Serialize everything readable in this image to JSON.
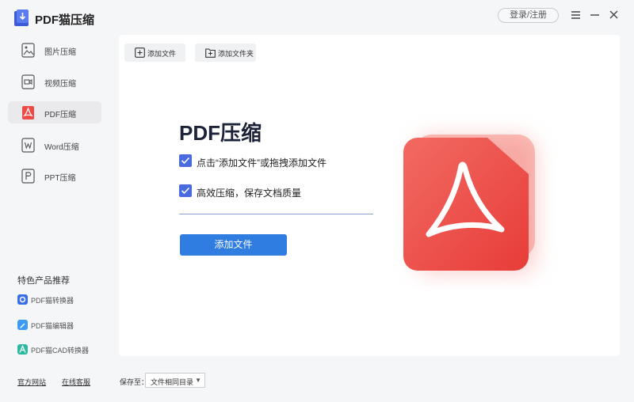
{
  "app": {
    "title": "PDF猫压缩",
    "login_label": "登录/注册"
  },
  "sidebar": {
    "items": [
      {
        "label": "图片压缩",
        "icon": "image-icon"
      },
      {
        "label": "视频压缩",
        "icon": "video-icon"
      },
      {
        "label": "PDF压缩",
        "icon": "pdf-icon",
        "active": true
      },
      {
        "label": "Word压缩",
        "icon": "word-icon"
      },
      {
        "label": "PPT压缩",
        "icon": "ppt-icon"
      }
    ],
    "recommend_title": "特色产品推荐",
    "recommend": [
      {
        "label": "PDF猫转换器",
        "icon": "pdf-converter-icon"
      },
      {
        "label": "PDF猫编辑器",
        "icon": "pdf-editor-icon"
      },
      {
        "label": "PDF猫CAD转换器",
        "icon": "cad-converter-icon"
      }
    ],
    "footer": {
      "website": "官方网站",
      "support": "在线客服"
    }
  },
  "toolbar": {
    "add_file": "添加文件",
    "add_folder": "添加文件夹"
  },
  "main": {
    "title": "PDF压缩",
    "checks": [
      {
        "label": "点击“添加文件”或拖拽添加文件",
        "checked": true
      },
      {
        "label": "高效压缩，保存文档质量",
        "checked": true
      }
    ],
    "add_button": "添加文件"
  },
  "bottom": {
    "save_to_label": "保存至：",
    "save_to_value": "文件相同目录"
  },
  "colors": {
    "accent": "#2f7de1",
    "checkbox": "#4a6be0",
    "pdf_red": "#ee4a45"
  }
}
